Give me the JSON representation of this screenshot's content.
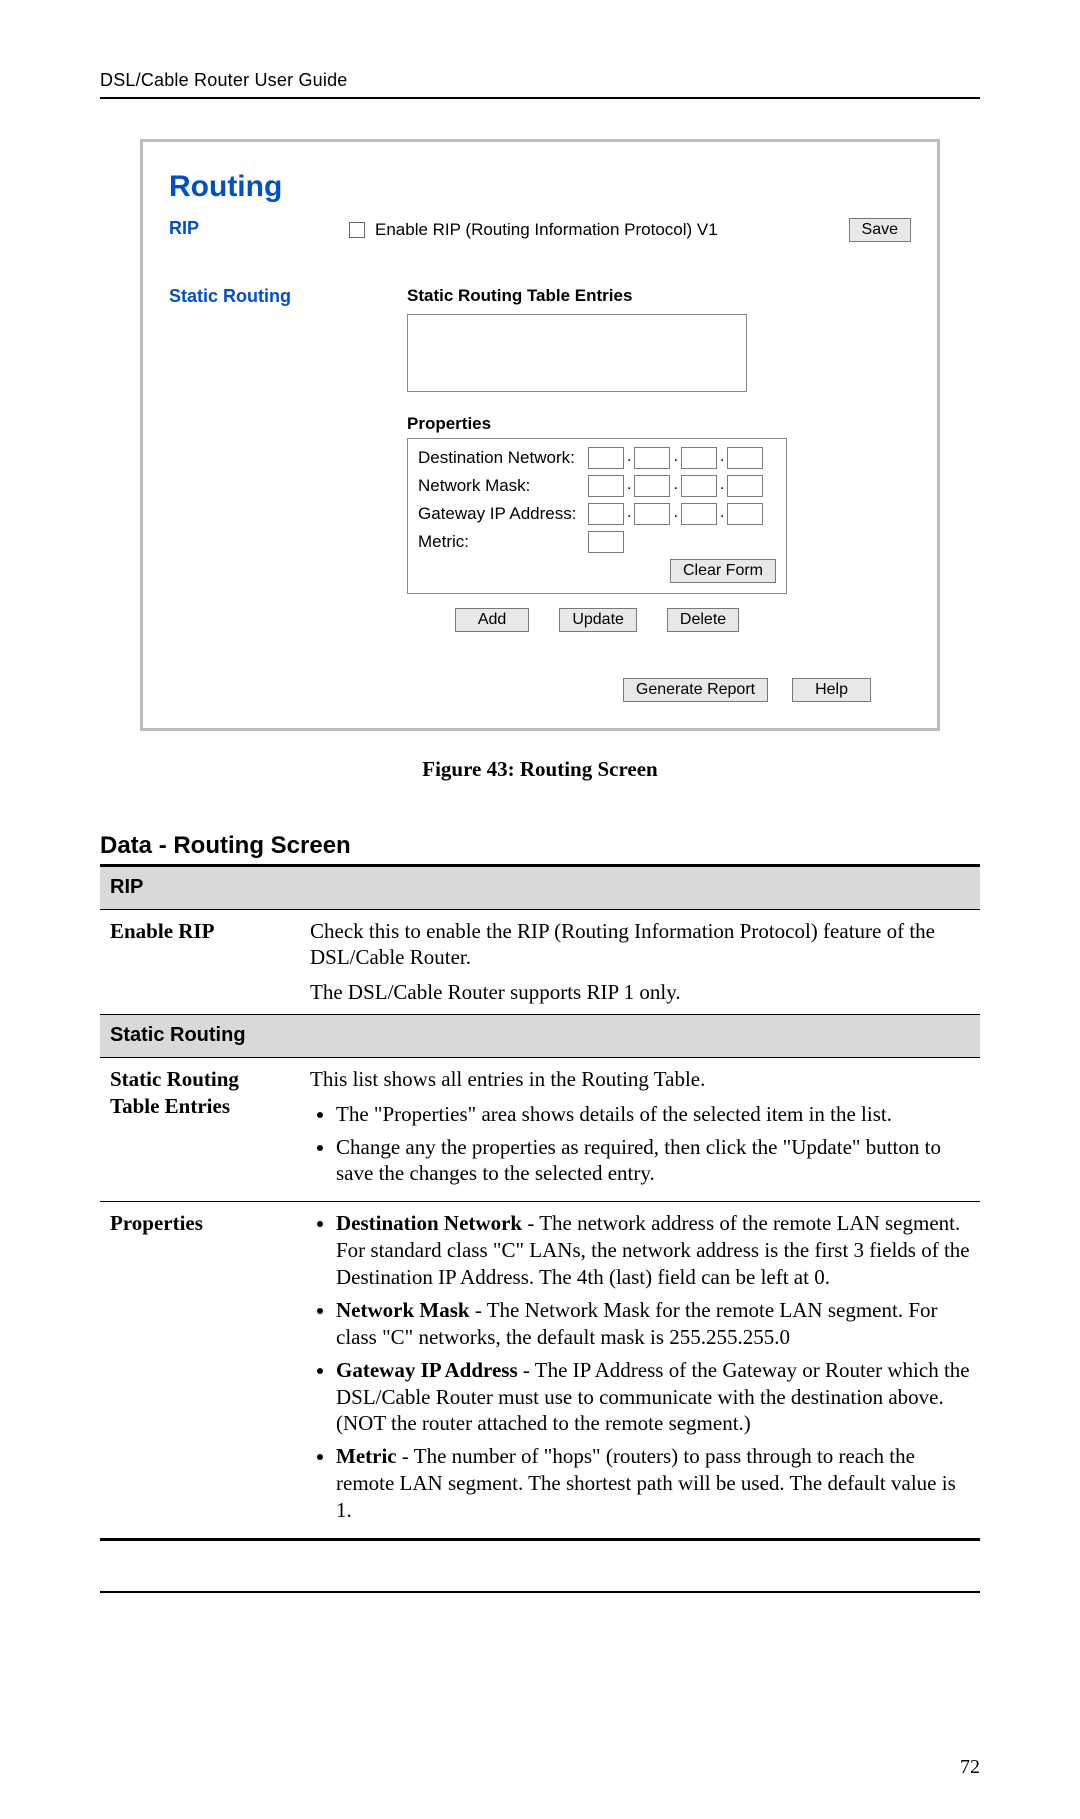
{
  "header": {
    "title": "DSL/Cable Router User Guide"
  },
  "page_number": "72",
  "router": {
    "title": "Routing",
    "rip_label": "RIP",
    "static_routing_label": "Static Routing",
    "enable_rip_text": "Enable RIP (Routing Information Protocol) V1",
    "save_btn": "Save",
    "table_entries_heading": "Static Routing Table Entries",
    "properties_heading": "Properties",
    "prop_dest_network": "Destination Network:",
    "prop_network_mask": "Network Mask:",
    "prop_gateway": "Gateway IP Address:",
    "prop_metric": "Metric:",
    "clear_form_btn": "Clear Form",
    "add_btn": "Add",
    "update_btn": "Update",
    "delete_btn": "Delete",
    "generate_report_btn": "Generate Report",
    "help_btn": "Help"
  },
  "figure_caption": "Figure 43: Routing Screen",
  "section_heading": "Data - Routing Screen",
  "table": {
    "rip_header": "RIP",
    "enable_rip_label": "Enable RIP",
    "enable_rip_desc_1": "Check this to enable the RIP (Routing Information Protocol) feature of the DSL/Cable Router.",
    "enable_rip_desc_2": "The DSL/Cable Router supports RIP 1 only.",
    "static_header": "Static Routing",
    "entries_label_1": "Static Routing",
    "entries_label_2": "Table Entries",
    "entries_desc_lead": "This list shows all entries in the Routing Table.",
    "entries_bullet_1": "The \"Properties\" area shows details of the selected item in the list.",
    "entries_bullet_2": "Change any the properties as required, then click the \"Update\" button to save the changes to the selected entry.",
    "properties_label": "Properties",
    "prop_b1_name": "Destination Network",
    "prop_b1_text": " - The network address of the remote LAN segment. For standard class \"C\" LANs, the network address is the first 3 fields of the Destination IP Address. The 4th (last) field can be left at 0.",
    "prop_b2_name": "Network Mask",
    "prop_b2_text": " - The Network Mask for the remote LAN segment. For class \"C\" networks, the default mask is 255.255.255.0",
    "prop_b3_name": "Gateway IP Address",
    "prop_b3_text": " - The IP Address of the Gateway or Router which the DSL/Cable Router must use to communicate with the destination above. (NOT the router attached to the remote segment.)",
    "prop_b4_name": "Metric",
    "prop_b4_text": " - The number of \"hops\" (routers) to pass through to reach the remote LAN segment. The shortest path will be used. The default value is 1."
  }
}
